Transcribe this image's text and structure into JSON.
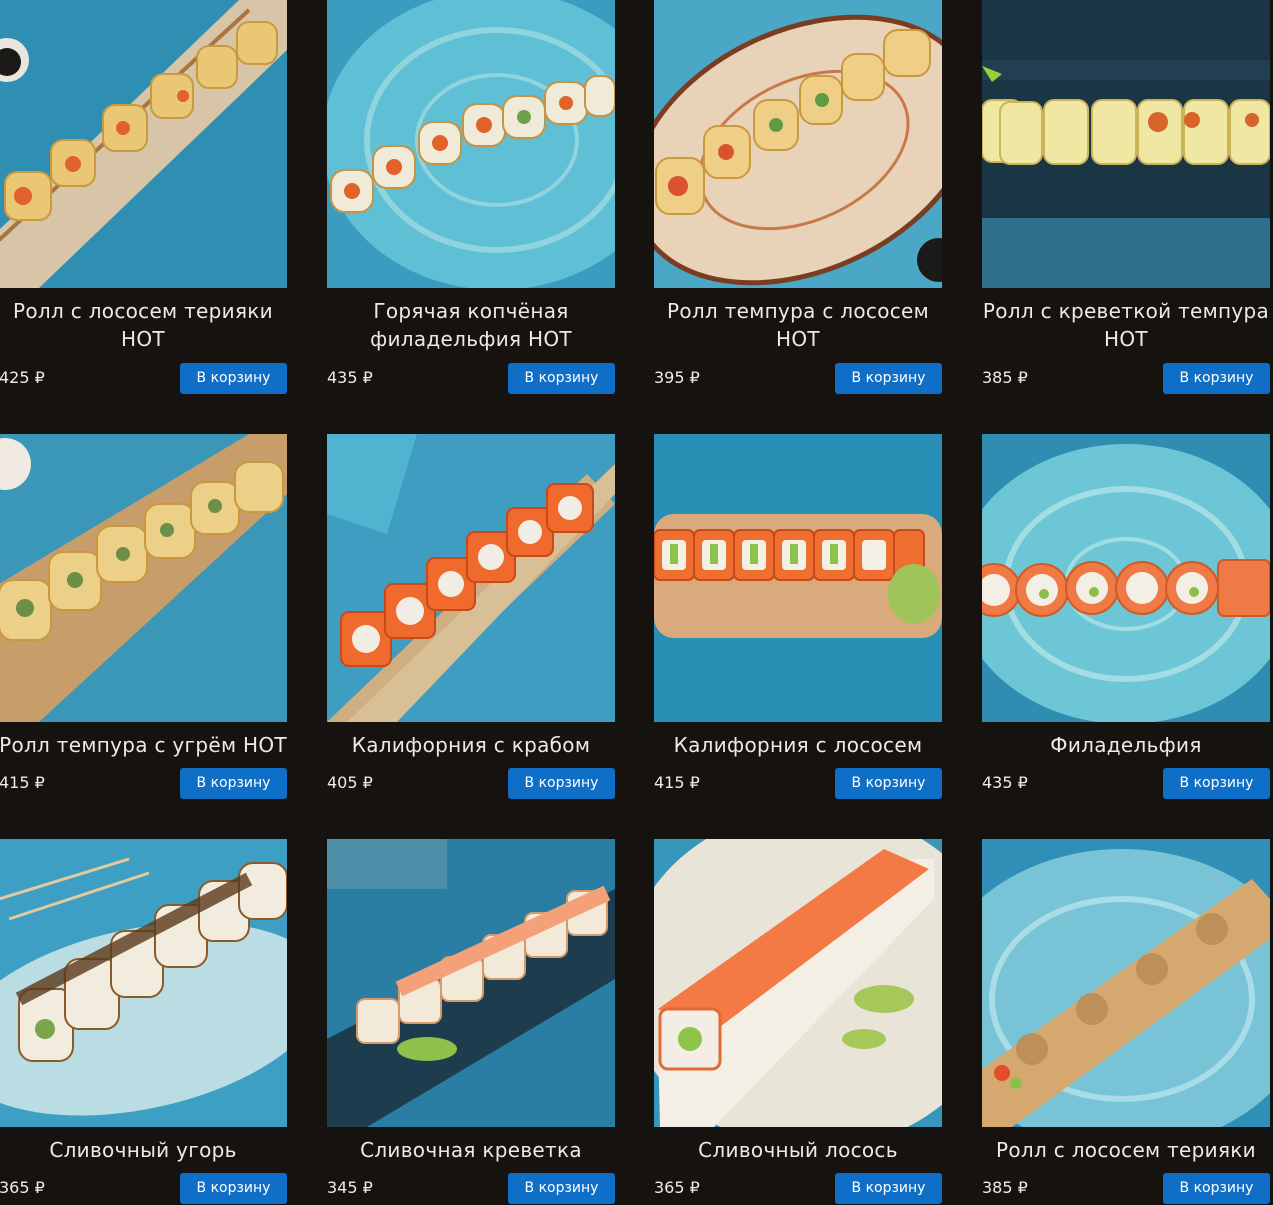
{
  "products": [
    {
      "name": "Ролл с лососем терияки HOT",
      "price": "425 ₽",
      "button": "В корзину",
      "photo": "roll-photo"
    },
    {
      "name": "Горячая копчёная филадельфия HOT",
      "price": "435 ₽",
      "button": "В корзину",
      "photo": "roll-photo"
    },
    {
      "name": "Ролл темпура с лососем HOT",
      "price": "395 ₽",
      "button": "В корзину",
      "photo": "roll-photo"
    },
    {
      "name": "Ролл с креветкой темпура HOT",
      "price": "385 ₽",
      "button": "В корзину",
      "photo": "roll-photo"
    },
    {
      "name": "Ролл темпура с угрём HOT",
      "price": "415 ₽",
      "button": "В корзину",
      "photo": "roll-photo"
    },
    {
      "name": "Калифорния с крабом",
      "price": "405 ₽",
      "button": "В корзину",
      "photo": "roll-photo"
    },
    {
      "name": "Калифорния с лососем",
      "price": "415 ₽",
      "button": "В корзину",
      "photo": "roll-photo"
    },
    {
      "name": "Филадельфия",
      "price": "435 ₽",
      "button": "В корзину",
      "photo": "roll-photo"
    },
    {
      "name": "Сливочный угорь",
      "price": "365 ₽",
      "button": "В корзину",
      "photo": "roll-photo"
    },
    {
      "name": "Сливочная креветка",
      "price": "345 ₽",
      "button": "В корзину",
      "photo": "roll-photo"
    },
    {
      "name": "Сливочный лосось",
      "price": "365 ₽",
      "button": "В корзину",
      "photo": "roll-photo"
    },
    {
      "name": "Ролл с лососем терияки",
      "price": "385 ₽",
      "button": "В корзину",
      "photo": "roll-photo"
    }
  ],
  "colors": {
    "page_background": "#16120f",
    "button_background": "#0f6fc6",
    "button_text": "#ffffff",
    "text": "#efe9e1"
  }
}
